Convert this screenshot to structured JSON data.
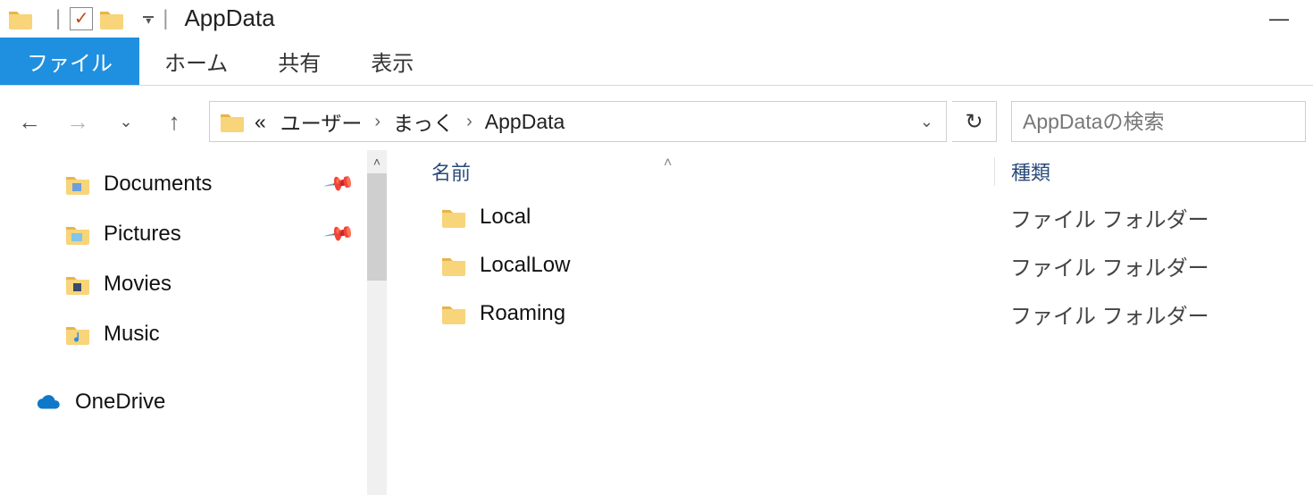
{
  "title": "AppData",
  "ribbon": {
    "file": "ファイル",
    "tabs": [
      "ホーム",
      "共有",
      "表示"
    ]
  },
  "breadcrumb": {
    "overflow": "«",
    "parts": [
      "ユーザー",
      "まっく",
      "AppData"
    ]
  },
  "search": {
    "placeholder": "AppDataの検索"
  },
  "nav_items": [
    {
      "label": "Documents",
      "icon": "documents",
      "pinned": true
    },
    {
      "label": "Pictures",
      "icon": "pictures",
      "pinned": true
    },
    {
      "label": "Movies",
      "icon": "movies",
      "pinned": false
    },
    {
      "label": "Music",
      "icon": "music",
      "pinned": false
    }
  ],
  "nav_cloud": {
    "label": "OneDrive"
  },
  "columns": {
    "name": "名前",
    "type": "種類"
  },
  "rows": [
    {
      "name": "Local",
      "type": "ファイル フォルダー"
    },
    {
      "name": "LocalLow",
      "type": "ファイル フォルダー"
    },
    {
      "name": "Roaming",
      "type": "ファイル フォルダー"
    }
  ]
}
